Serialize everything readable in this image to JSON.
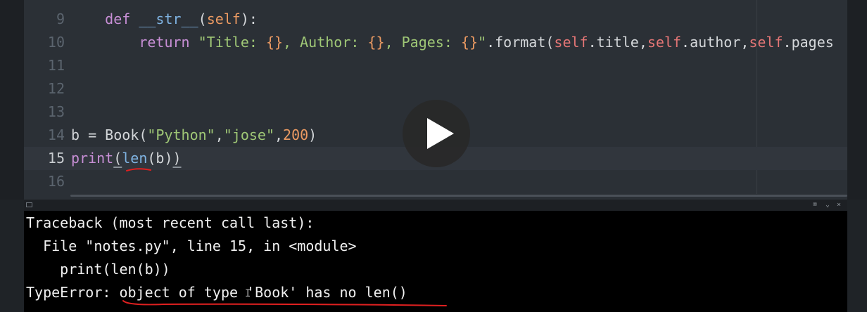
{
  "editor": {
    "lines": [
      {
        "num": "9",
        "parts": [
          {
            "t": "    ",
            "c": "tx"
          },
          {
            "t": "def",
            "c": "kw"
          },
          {
            "t": " ",
            "c": "tx"
          },
          {
            "t": "__str__",
            "c": "fn"
          },
          {
            "t": "(",
            "c": "tx"
          },
          {
            "t": "self",
            "c": "num"
          },
          {
            "t": "):",
            "c": "tx"
          }
        ]
      },
      {
        "num": "10",
        "parts": [
          {
            "t": "        ",
            "c": "tx"
          },
          {
            "t": "return",
            "c": "kw"
          },
          {
            "t": " ",
            "c": "tx"
          },
          {
            "t": "\"Title: ",
            "c": "str"
          },
          {
            "t": "{}",
            "c": "num"
          },
          {
            "t": ", Author: ",
            "c": "str"
          },
          {
            "t": "{}",
            "c": "num"
          },
          {
            "t": ", Pages: ",
            "c": "str"
          },
          {
            "t": "{}",
            "c": "num"
          },
          {
            "t": "\"",
            "c": "str"
          },
          {
            "t": ".format(",
            "c": "tx"
          },
          {
            "t": "self",
            "c": "self"
          },
          {
            "t": ".title,",
            "c": "tx"
          },
          {
            "t": "self",
            "c": "self"
          },
          {
            "t": ".author,",
            "c": "tx"
          },
          {
            "t": "self",
            "c": "self"
          },
          {
            "t": ".pages",
            "c": "tx"
          }
        ]
      },
      {
        "num": "11",
        "parts": []
      },
      {
        "num": "12",
        "parts": []
      },
      {
        "num": "13",
        "parts": []
      },
      {
        "num": "14",
        "parts": [
          {
            "t": "b = Book(",
            "c": "tx"
          },
          {
            "t": "\"Python\"",
            "c": "str"
          },
          {
            "t": ",",
            "c": "tx"
          },
          {
            "t": "\"jose\"",
            "c": "str"
          },
          {
            "t": ",",
            "c": "tx"
          },
          {
            "t": "200",
            "c": "num"
          },
          {
            "t": ")",
            "c": "tx"
          }
        ]
      },
      {
        "num": "15",
        "current": true,
        "parts": [
          {
            "t": "print",
            "c": "kw"
          },
          {
            "t": "(",
            "c": "tx ul-bracket"
          },
          {
            "t": "len",
            "c": "fn"
          },
          {
            "t": "(b)",
            "c": "tx"
          },
          {
            "t": ")",
            "c": "tx ul-bracket"
          }
        ]
      },
      {
        "num": "16",
        "parts": []
      }
    ]
  },
  "console": {
    "lines": [
      "Traceback (most recent call last):",
      "  File \"notes.py\", line 15, in <module>",
      "    print(len(b))",
      "TypeError: object of type 'Book' has no len()"
    ]
  },
  "panel": {
    "controls": [
      "⌧",
      "⌄",
      "×"
    ]
  },
  "video": {
    "play_icon": "play-icon"
  },
  "colors": {
    "keyword": "#c88fd6",
    "function": "#7fb3e2",
    "string": "#9fc776",
    "number": "#eb9a62",
    "self": "#e57676",
    "annotation": "#e02020"
  }
}
